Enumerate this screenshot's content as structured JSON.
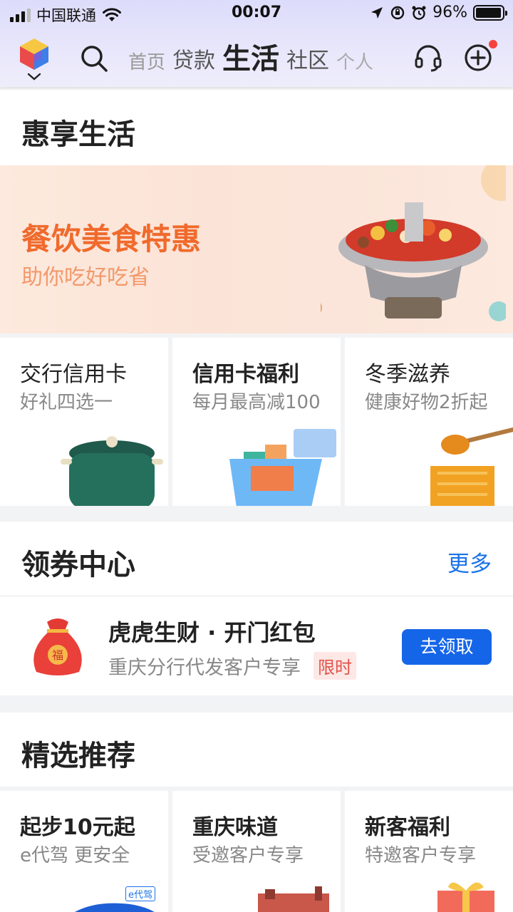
{
  "status_bar": {
    "carrier": "中国联通",
    "time": "00:07",
    "battery_percent": "96%",
    "battery_level": 0.96
  },
  "nav": {
    "tabs": [
      "首页",
      "贷款",
      "生活",
      "社区",
      "个人"
    ],
    "active_tab": "生活"
  },
  "hui_section": {
    "title": "惠享生活",
    "banner": {
      "title": "餐饮美食特惠",
      "subtitle": "助你吃好吃省"
    },
    "cards": [
      {
        "title": "交行信用卡",
        "subtitle": "好礼四选一"
      },
      {
        "title": "信用卡福利",
        "subtitle": "每月最高减100"
      },
      {
        "title": "冬季滋养",
        "subtitle": "健康好物2折起"
      }
    ]
  },
  "coupon_section": {
    "title": "领券中心",
    "more": "更多",
    "item": {
      "title": "虎虎生财 · 开门红包",
      "subtitle": "重庆分行代发客户专享",
      "tag": "限时",
      "button": "去领取",
      "bag_char": "福"
    }
  },
  "recommend_section": {
    "title": "精选推荐",
    "cards": [
      {
        "title": "起步10元起",
        "subtitle": "e代驾 更安全",
        "brand": "e代驾"
      },
      {
        "title": "重庆味道",
        "subtitle": "受邀客户专享"
      },
      {
        "title": "新客福利",
        "subtitle": "特邀客户专享"
      }
    ]
  },
  "colors": {
    "accent_blue": "#1565e8",
    "banner_orange": "#f06a2c",
    "notification_red": "#f5423f"
  }
}
